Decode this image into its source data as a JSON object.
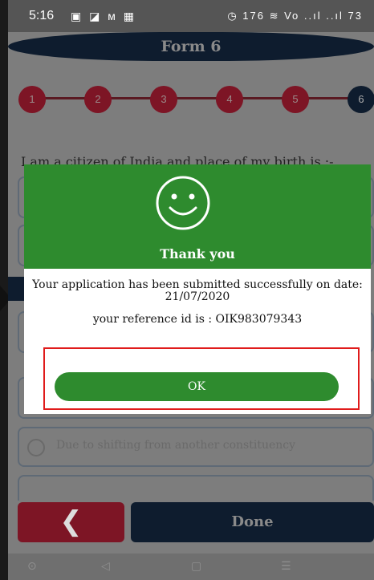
{
  "status_bar": {
    "time": "5:16",
    "left_icons": "▣ ◪ ᴍ ▦",
    "right_icons": "◷ 176 ≋ Vo ..ıl ..ıl 73"
  },
  "header": {
    "title": "Form 6"
  },
  "steps": [
    "1",
    "2",
    "3",
    "4",
    "5",
    "6"
  ],
  "form": {
    "question": "I am a citizen of India and place of my birth is :-",
    "radio_option": "Due to shifting from another constituency"
  },
  "footer": {
    "back_icon": "chevron-left-icon",
    "back_glyph": "❮",
    "done_label": "Done"
  },
  "nav": {
    "icons": [
      "⊙",
      "◁",
      "▢",
      "☰"
    ]
  },
  "dialog": {
    "heading": "Thank you",
    "message": "Your application has been submitted successfully on date: 21/07/2020",
    "reference": "your reference id is : OIK983079343",
    "ok_label": "OK"
  },
  "colors": {
    "green": "#2e8b2e",
    "navy": "#0e1c2e",
    "maroon": "#7d1525",
    "highlight": "#e01b1b"
  }
}
